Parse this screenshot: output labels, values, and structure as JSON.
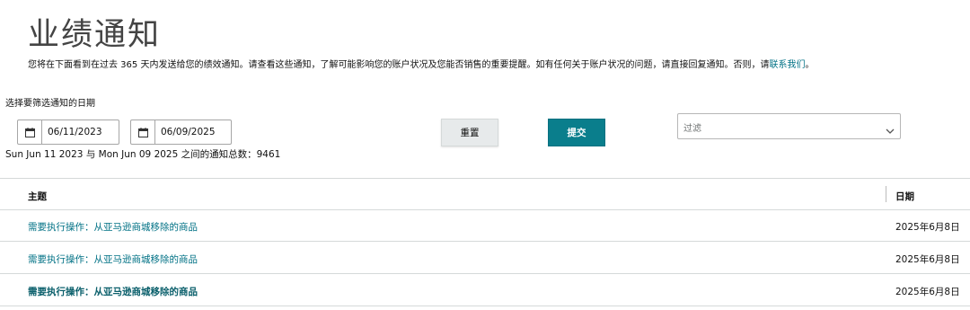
{
  "page": {
    "title": "业绩通知",
    "intro_text": "您将在下面看到在过去 365 天内发送给您的绩效通知。请查看这些通知，了解可能影响您的账户状况及您能否销售的重要提醒。如有任何关于账户状况的问题，请直接回复通知。否则，请",
    "intro_link": "联系我们",
    "intro_end": "。"
  },
  "filters": {
    "date_label": "选择要筛选通知的日期",
    "start_date": "06/11/2023",
    "end_date": "06/09/2025",
    "reset_label": "重置",
    "submit_label": "提交",
    "filter_placeholder": "过滤",
    "count_text": "Sun Jun 11 2023 与 Mon Jun 09 2025 之间的通知总数：9461"
  },
  "table": {
    "columns": [
      "主题",
      "日期"
    ],
    "rows": [
      {
        "subject": "需要执行操作：从亚马逊商城移除的商品",
        "date": "2025年6月8日",
        "unread": false
      },
      {
        "subject": "需要执行操作：从亚马逊商城移除的商品",
        "date": "2025年6月8日",
        "unread": false
      },
      {
        "subject": "需要执行操作：从亚马逊商城移除的商品",
        "date": "2025年6月8日",
        "unread": true
      }
    ]
  },
  "colors": {
    "accent": "#0a7e8c",
    "link": "#007185"
  },
  "icons": {
    "date": "calendar-icon",
    "dropdown": "chevron-down-icon"
  }
}
